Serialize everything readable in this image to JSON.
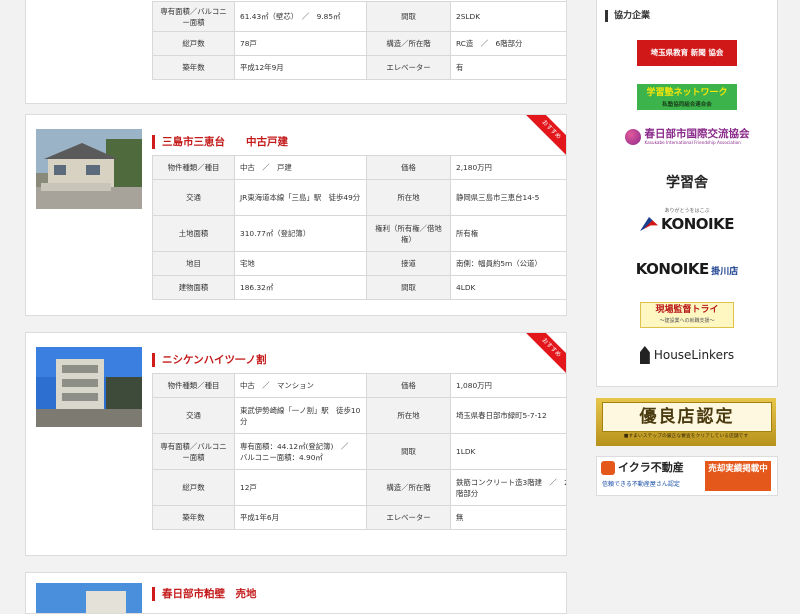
{
  "listings": [
    {
      "specs": [
        [
          "専有面積／バルコニー面積",
          "61.43㎡（壁芯）　／　9.85㎡",
          "間取",
          "2SLDK"
        ],
        [
          "総戸数",
          "78戸",
          "構造／所在階",
          "RC造　／　6階部分"
        ],
        [
          "築年数",
          "平成12年9月",
          "エレベーター",
          "有"
        ]
      ]
    },
    {
      "title": "三島市三恵台　　中古戸建",
      "badge": "おすすめ",
      "specs": [
        [
          "物件種類／種目",
          "中古　／　戸建",
          "価格",
          "2,180万円"
        ],
        [
          "交通",
          "JR東海道本線「三島」駅　徒歩49分",
          "所在地",
          "静岡県三島市三恵台14-5"
        ],
        [
          "土地面積",
          "310.77㎡（登記簿）",
          "権利（所有権／借地権）",
          "所有権"
        ],
        [
          "地目",
          "宅地",
          "接道",
          "南側：幅員約5m（公道）"
        ],
        [
          "建物面積",
          "186.32㎡",
          "間取",
          "4LDK"
        ]
      ]
    },
    {
      "title": "ニシケンハイツ一ノ割",
      "badge": "おすすめ",
      "specs": [
        [
          "物件種類／種目",
          "中古　／　マンション",
          "価格",
          "1,080万円"
        ],
        [
          "交通",
          "東武伊勢崎線「一ノ割」駅　徒歩10分",
          "所在地",
          "埼玉県春日部市緑町5-7-12"
        ],
        [
          "専有面積／バルコニー面積",
          "専有面積：44.12㎡(登記簿)　／　バルコニー面積：4.90㎡",
          "間取",
          "1LDK"
        ],
        [
          "総戸数",
          "12戸",
          "構造／所在階",
          "鉄筋コンクリート造3階建　／　2階部分"
        ],
        [
          "築年数",
          "平成1年6月",
          "エレベーター",
          "無"
        ]
      ]
    },
    {
      "title": "春日部市粕壁　売地"
    }
  ],
  "sidebar": {
    "heading": "協力企業",
    "logos": {
      "l1": "埼玉県教育 新聞 協会",
      "l2": "学習塾ネットワーク",
      "l2sub": "私塾協同組合連合会",
      "l3": "春日部市国際交流協会",
      "l3sub": "Kasukabe International Friendship Association",
      "l4": "学習舎",
      "l5": "KONOIKE",
      "l5sub": "ありがとうをはこぶ",
      "l6": "KONOIKE",
      "l6sub": "掛川店",
      "l7": "現場監督トライ",
      "l7sub": "〜建設業への就職支援〜",
      "l8": "HouseLinkers"
    }
  },
  "banners": {
    "yuryo_title": "優良店認定",
    "yuryo_sub": "■すまいステップの厳正な審査をクリアしている店舗です",
    "ikura_title": "イクラ不動産",
    "ikura_sub": "信頼できる不動産屋さん認定",
    "ikura_btn": "売却実績掲載中"
  },
  "colors": {
    "accent": "#d11a1a",
    "gold": "#b8921c",
    "ikura": "#e5581c"
  }
}
